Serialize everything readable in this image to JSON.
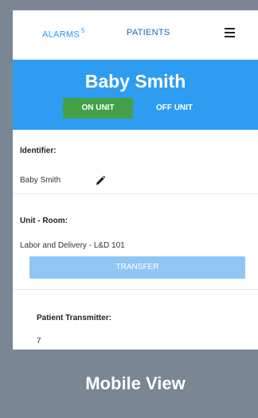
{
  "nav": {
    "alarms_label": "ALARMS",
    "alarms_count": "5",
    "patients_label": "PATIENTS",
    "menu_icon": "hamburger-menu-icon"
  },
  "header": {
    "patient_name": "Baby Smith",
    "on_unit_label": "ON UNIT",
    "off_unit_label": "OFF UNIT"
  },
  "identifier": {
    "label": "Identifier:",
    "value": "Baby Smith",
    "edit_icon": "pencil-icon"
  },
  "unit_room": {
    "label": "Unit - Room:",
    "value": "Labor and Delivery - L&D 101",
    "transfer_label": "TRANSFER"
  },
  "transmitter": {
    "label": "Patient Transmitter:",
    "value": "7"
  },
  "caption": "Mobile View",
  "colors": {
    "accent_blue": "#2e9cf0",
    "on_unit_green": "#43a047",
    "transfer_blue": "#90c6f4",
    "frame_gray": "#7a8694"
  }
}
